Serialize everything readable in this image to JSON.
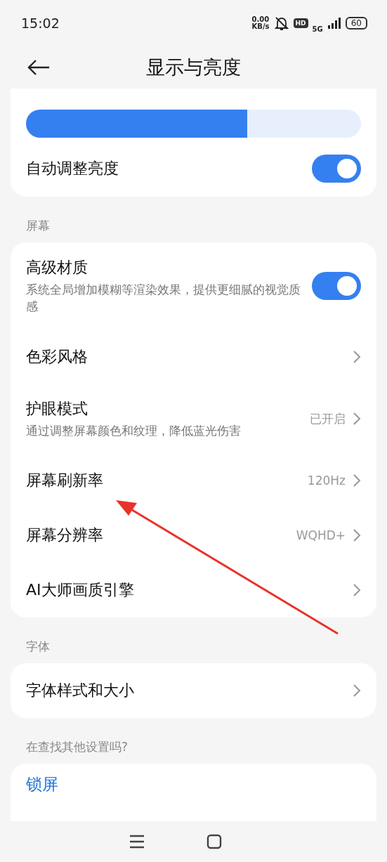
{
  "status_bar": {
    "time": "15:02",
    "net_speed": "0.00",
    "net_unit": "KB/s",
    "hd": "HD",
    "network": "5G",
    "battery": "60"
  },
  "header": {
    "title": "显示与亮度"
  },
  "brightness": {
    "level": 0.66,
    "auto_label": "自动调整亮度",
    "auto_on": true
  },
  "sections": [
    {
      "label": "屏幕",
      "rows": [
        {
          "kind": "toggle",
          "title": "高级材质",
          "subtitle": "系统全局增加模糊等渲染效果，提供更细腻的视觉质感",
          "on": true
        },
        {
          "kind": "link",
          "title": "色彩风格"
        },
        {
          "kind": "link",
          "title": "护眼模式",
          "subtitle": "通过调整屏幕颜色和纹理，降低蓝光伤害",
          "value": "已开启"
        },
        {
          "kind": "link",
          "title": "屏幕刷新率",
          "value": "120Hz"
        },
        {
          "kind": "link",
          "title": "屏幕分辨率",
          "value": "WQHD+"
        },
        {
          "kind": "link",
          "title": "AI大师画质引擎"
        }
      ]
    },
    {
      "label": "字体",
      "rows": [
        {
          "kind": "link",
          "title": "字体样式和大小"
        }
      ]
    }
  ],
  "search_more": {
    "label": "在查找其他设置吗?",
    "items": [
      "锁屏"
    ]
  },
  "annotation": {
    "kind": "arrow"
  }
}
